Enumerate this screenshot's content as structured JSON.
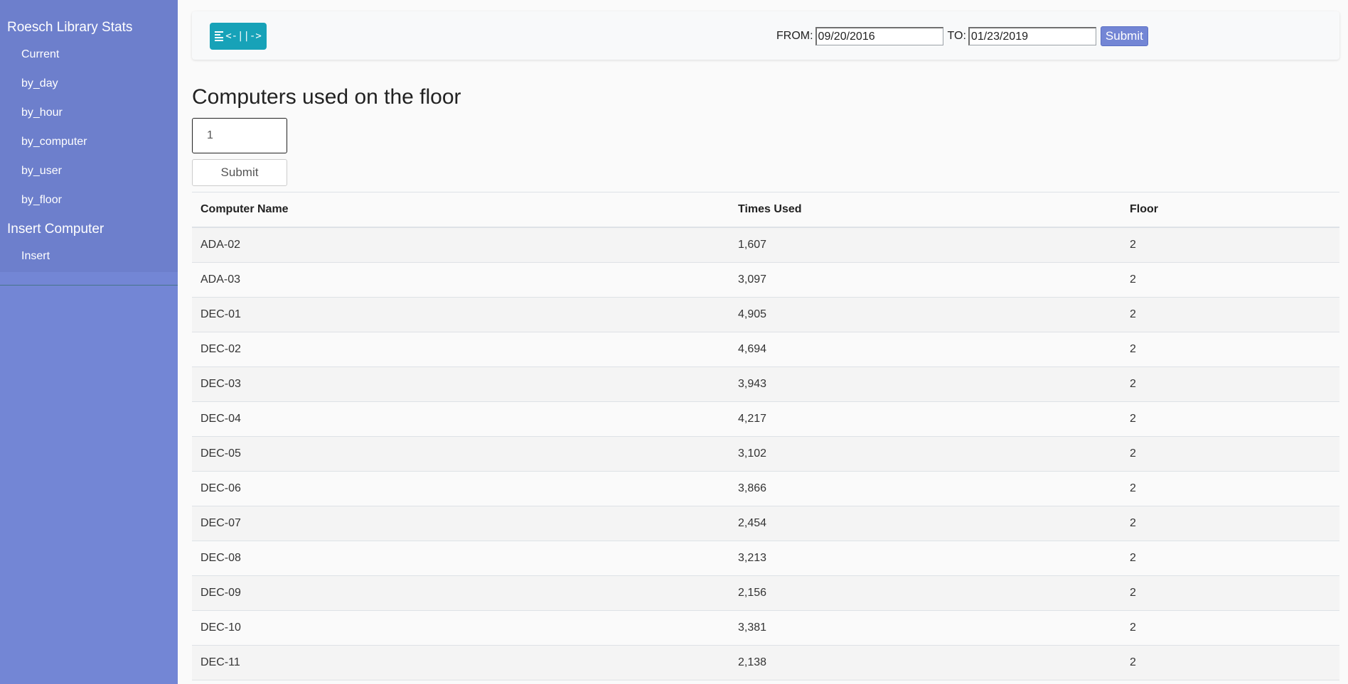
{
  "sidebar": {
    "title": "Roesch Library Stats",
    "stats_items": [
      "Current",
      "by_day",
      "by_hour",
      "by_computer",
      "by_user",
      "by_floor"
    ],
    "insert_title": "Insert Computer",
    "insert_items": [
      "Insert"
    ]
  },
  "topbar": {
    "toggle_label": "<-||->",
    "from_label": "FROM:",
    "from_value": "09/20/2016",
    "to_label": "TO:",
    "to_value": "01/23/2019",
    "submit_label": "Submit"
  },
  "main": {
    "title": "Computers used on the floor",
    "floor_input_value": "1",
    "submit_label": "Submit"
  },
  "table": {
    "headers": [
      "Computer Name",
      "Times Used",
      "Floor"
    ],
    "rows": [
      [
        "ADA-02",
        "1,607",
        "2"
      ],
      [
        "ADA-03",
        "3,097",
        "2"
      ],
      [
        "DEC-01",
        "4,905",
        "2"
      ],
      [
        "DEC-02",
        "4,694",
        "2"
      ],
      [
        "DEC-03",
        "3,943",
        "2"
      ],
      [
        "DEC-04",
        "4,217",
        "2"
      ],
      [
        "DEC-05",
        "3,102",
        "2"
      ],
      [
        "DEC-06",
        "3,866",
        "2"
      ],
      [
        "DEC-07",
        "2,454",
        "2"
      ],
      [
        "DEC-08",
        "3,213",
        "2"
      ],
      [
        "DEC-09",
        "2,156",
        "2"
      ],
      [
        "DEC-10",
        "3,381",
        "2"
      ],
      [
        "DEC-11",
        "2,138",
        "2"
      ]
    ]
  },
  "colors": {
    "sidebar_bg": "#7386d5",
    "sidebar_menu_bg": "#6d7fcc",
    "toggle_btn": "#17a2b8"
  }
}
